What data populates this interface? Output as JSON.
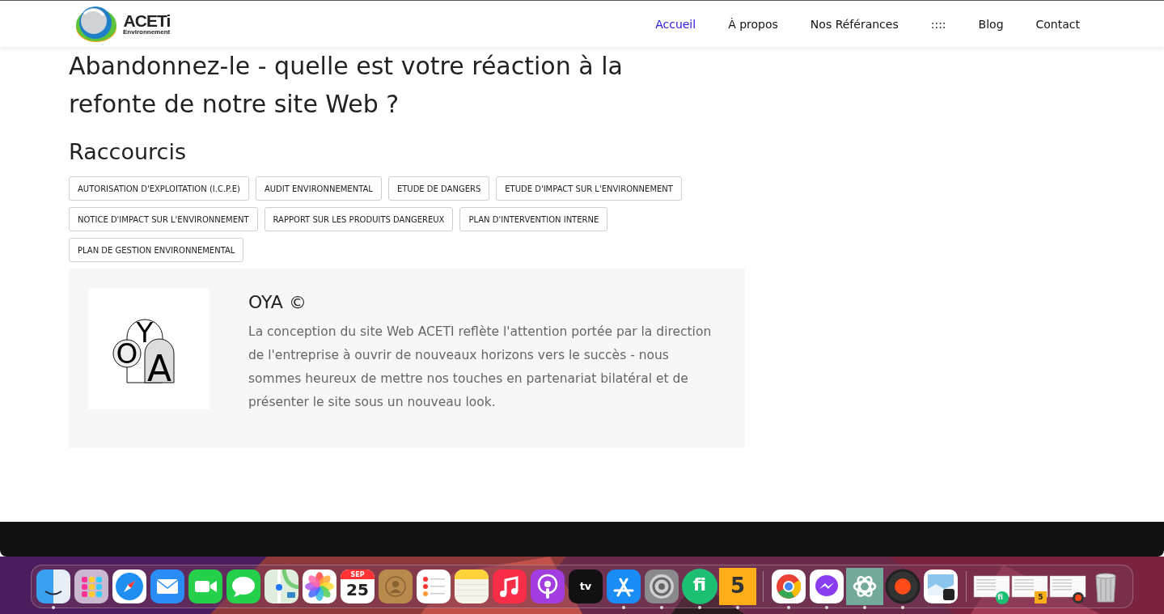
{
  "header": {
    "logo": {
      "name": "ACETi",
      "tagline": "Environnement"
    },
    "nav": [
      {
        "label": "Accueil",
        "selected": true
      },
      {
        "label": "À propos",
        "selected": false
      },
      {
        "label": "Nos Référances",
        "selected": false
      },
      {
        "label": "::::",
        "selected": false
      },
      {
        "label": "Blog",
        "selected": false
      },
      {
        "label": "Contact",
        "selected": false
      }
    ]
  },
  "article": {
    "title": "Abandonnez-le - quelle est votre réaction à la refonte de notre site Web ?"
  },
  "shortcuts": {
    "heading": "Raccourcis",
    "tags": [
      "AUTORISATION D'EXPLOITATION (I.C.P.E)",
      "AUDIT ENVIRONNEMENTAL",
      "ETUDE DE DANGERS",
      "ETUDE D'IMPACT SUR L'ENVIRONNEMENT",
      "NOTICE D'IMPACT SUR L'ENVIRONNEMENT",
      "RAPPORT SUR LES PRODUITS DANGEREUX",
      "PLAN D'INTERVENTION INTERNE",
      "PLAN DE GESTION ENVIRONNEMENTAL"
    ]
  },
  "author": {
    "logo_letters": [
      "O",
      "Y",
      "A"
    ],
    "name": "OYA ©",
    "bio": "La conception du site Web ACETI reflète l'attention portée par la direction de l'entreprise à ouvrir de nouveaux horizons vers le succès - nous sommes heureux de mettre nos touches en partenariat bilatéral et de présenter le site sous un nouveau look."
  },
  "dock": {
    "items": [
      {
        "kind": "finder",
        "running": true
      },
      {
        "kind": "launchpad",
        "running": false
      },
      {
        "kind": "safari",
        "running": false
      },
      {
        "kind": "mail",
        "running": false
      },
      {
        "kind": "facetime",
        "running": false
      },
      {
        "kind": "messages",
        "running": false
      },
      {
        "kind": "maps",
        "running": false
      },
      {
        "kind": "photos",
        "running": false
      },
      {
        "kind": "calendar",
        "running": false,
        "month": "SEP",
        "day": "25"
      },
      {
        "kind": "contacts",
        "running": false
      },
      {
        "kind": "reminders",
        "running": false
      },
      {
        "kind": "notes",
        "running": false
      },
      {
        "kind": "music",
        "running": false
      },
      {
        "kind": "podcasts",
        "running": false
      },
      {
        "kind": "tv",
        "running": false,
        "label": "tv"
      },
      {
        "kind": "appstore",
        "running": true
      },
      {
        "kind": "settings",
        "running": true
      },
      {
        "kind": "fiverr",
        "running": true,
        "label": "fi"
      },
      {
        "kind": "five",
        "running": true,
        "label": "5"
      },
      {
        "kind": "separator"
      },
      {
        "kind": "chrome",
        "running": true
      },
      {
        "kind": "messenger",
        "running": true
      },
      {
        "kind": "chatgpt",
        "running": true
      },
      {
        "kind": "recorder",
        "running": true
      },
      {
        "kind": "preview",
        "running": false
      },
      {
        "kind": "separator"
      },
      {
        "kind": "window",
        "running": false,
        "badge": {
          "kind": "fiverr",
          "label": "fi"
        }
      },
      {
        "kind": "window",
        "running": false,
        "badge": {
          "kind": "five",
          "label": "5"
        }
      },
      {
        "kind": "window",
        "running": false,
        "badge": {
          "kind": "recorder"
        }
      },
      {
        "kind": "trash",
        "running": false
      }
    ]
  }
}
